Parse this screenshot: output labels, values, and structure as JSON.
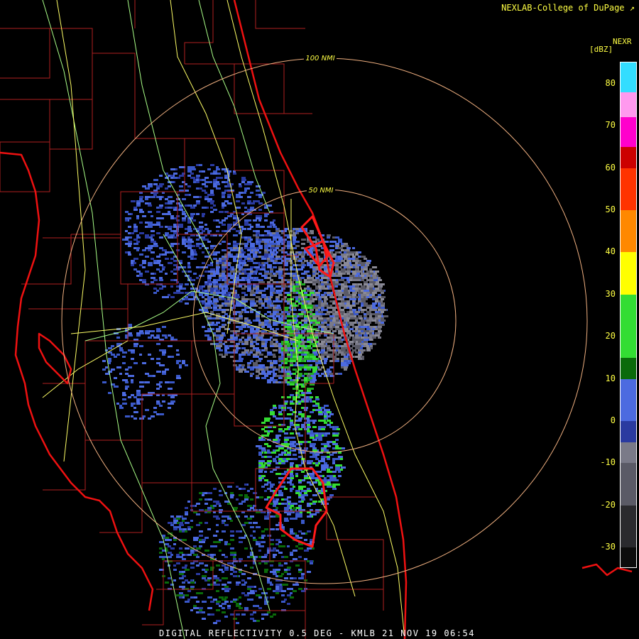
{
  "header": {
    "credit": "NEXLAB-College of DuPage",
    "credit_icon": "external-link-icon"
  },
  "map": {
    "rings": [
      {
        "label": "100 NMI"
      },
      {
        "label": "50 NMI"
      }
    ],
    "colors": {
      "coastline": "#ee1111",
      "counties": "#b02020",
      "roads": "#ffff66",
      "highways": "#aaff88",
      "rings": "#f0b080",
      "ring_labels": "#ffff44",
      "warning_polygons": "#ff1a1a"
    }
  },
  "legend": {
    "product": "NEXR",
    "unit": "[dBZ]",
    "ticks": [
      "80",
      "70",
      "60",
      "50",
      "40",
      "30",
      "20",
      "10",
      "0",
      "-10",
      "-20",
      "-30"
    ],
    "color_stops": [
      {
        "from": -35,
        "to": -30,
        "color": "#0c0c0c"
      },
      {
        "from": -30,
        "to": -20,
        "color": "#2a2a2e"
      },
      {
        "from": -20,
        "to": -10,
        "color": "#5a5a66"
      },
      {
        "from": -10,
        "to": -5,
        "color": "#7a7a88"
      },
      {
        "from": -5,
        "to": 0,
        "color": "#2a3aa0"
      },
      {
        "from": 0,
        "to": 10,
        "color": "#4c6ae0"
      },
      {
        "from": 10,
        "to": 15,
        "color": "#0a6a0a"
      },
      {
        "from": 15,
        "to": 30,
        "color": "#33dd33"
      },
      {
        "from": 30,
        "to": 40,
        "color": "#ffff00"
      },
      {
        "from": 40,
        "to": 50,
        "color": "#ff8800"
      },
      {
        "from": 50,
        "to": 60,
        "color": "#ff3300"
      },
      {
        "from": 60,
        "to": 65,
        "color": "#cc0000"
      },
      {
        "from": 65,
        "to": 72,
        "color": "#ff00cc"
      },
      {
        "from": 72,
        "to": 78,
        "color": "#ff99ee"
      },
      {
        "from": 78,
        "to": 85,
        "color": "#33ddff"
      }
    ],
    "range": [
      -35,
      85
    ]
  },
  "footer": {
    "caption": "DIGITAL REFLECTIVITY 0.5 DEG - KMLB 21 NOV 19 06:54"
  }
}
